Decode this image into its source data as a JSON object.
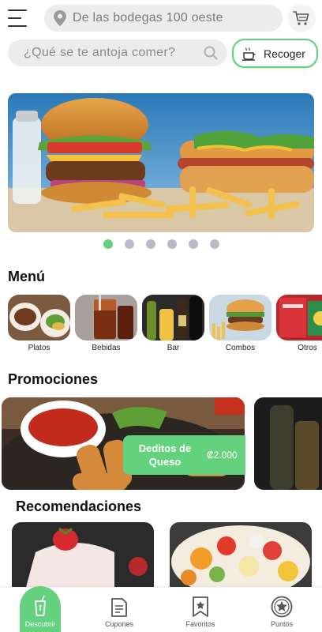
{
  "header": {
    "address": "De las bodegas 100 oeste",
    "search_placeholder": "¿Qué se te antoja comer?",
    "pickup_label": "Recoger"
  },
  "carousel": {
    "pages": 6,
    "active_index": 0
  },
  "menu": {
    "title": "Menú",
    "categories": [
      {
        "label": "Platos"
      },
      {
        "label": "Bebidas"
      },
      {
        "label": "Bar"
      },
      {
        "label": "Combos"
      },
      {
        "label": "Otros"
      }
    ]
  },
  "promotions": {
    "title": "Promociones",
    "items": [
      {
        "name": "Deditos de Queso",
        "price": "₡2.000"
      }
    ]
  },
  "recommendations": {
    "title": "Recomendaciones"
  },
  "bottom_nav": {
    "items": [
      {
        "label": "Descubrir",
        "active": true
      },
      {
        "label": "Cupones"
      },
      {
        "label": "Favoritos"
      },
      {
        "label": "Puntos"
      }
    ]
  },
  "colors": {
    "accent": "#63d17e",
    "field_bg": "#ececec",
    "dot_inactive": "#b9b9c7"
  },
  "icons": [
    "hamburger-icon",
    "location-pin-icon",
    "cart-icon",
    "search-icon",
    "pickup-icon",
    "descubrir-icon",
    "cupones-icon",
    "favoritos-icon",
    "puntos-icon"
  ]
}
